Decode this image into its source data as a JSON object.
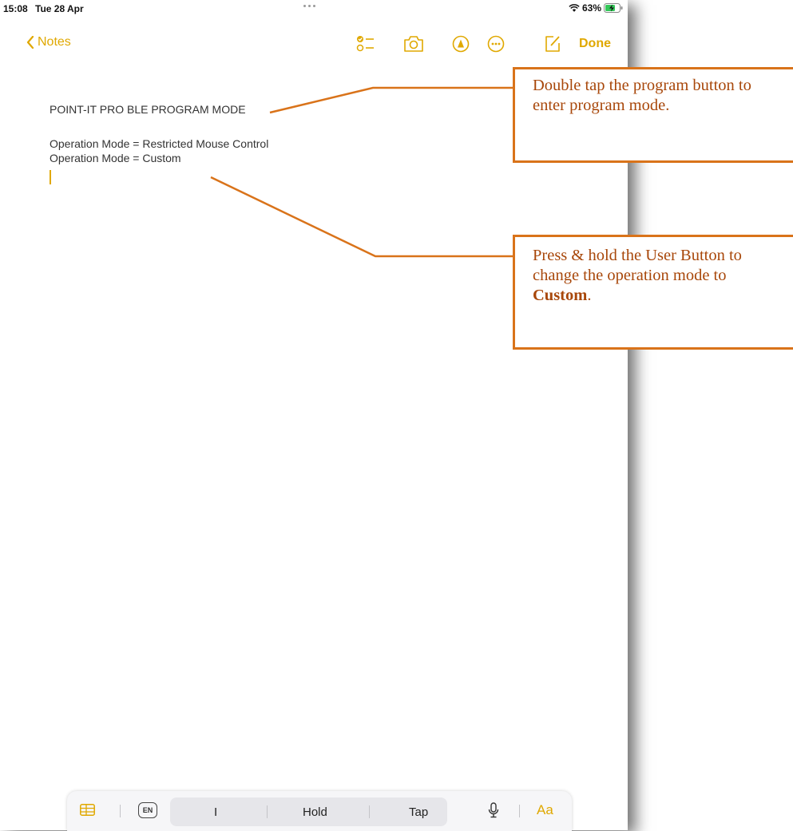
{
  "status_bar": {
    "time": "15:08",
    "date": "Tue 28 Apr",
    "battery": "63%"
  },
  "nav": {
    "back_label": "Notes",
    "done_label": "Done",
    "icons": [
      "checklist-icon",
      "camera-icon",
      "markup-icon",
      "more-icon",
      "compose-icon"
    ]
  },
  "note": {
    "title": "POINT-IT PRO BLE PROGRAM MODE",
    "lines": [
      "Operation Mode = Restricted Mouse Control",
      "Operation Mode = Custom"
    ]
  },
  "callouts": {
    "first": "Double tap the program button to enter program mode.",
    "second_prefix": "Press & hold the User Button to change the operation mode to ",
    "second_bold": "Custom",
    "second_suffix": "."
  },
  "keyboard_bar": {
    "lang": "EN",
    "suggestions": [
      "I",
      "Hold",
      "Tap"
    ],
    "format_label": "Aa"
  },
  "colors": {
    "accent": "#e0a800",
    "callout_border": "#d9731a",
    "callout_text": "#a8470a"
  }
}
